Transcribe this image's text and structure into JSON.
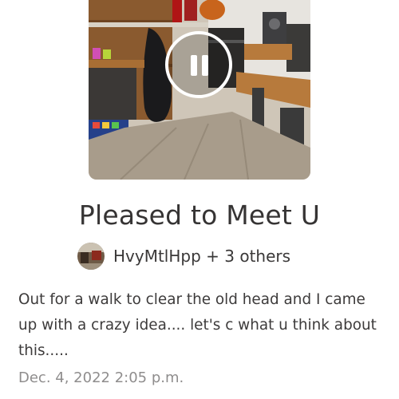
{
  "media": {
    "cover_icon": "room-photo",
    "play_state_icon": "pause-icon"
  },
  "song": {
    "title": "Pleased to Meet U"
  },
  "author": {
    "avatar_icon": "user-avatar",
    "name": "HvyMtlHpp + 3 others"
  },
  "post": {
    "description": "Out for a walk to clear the old head and I came up with a crazy idea.... let's c what u think about this.....",
    "timestamp": "Dec. 4, 2022 2:05 p.m."
  }
}
